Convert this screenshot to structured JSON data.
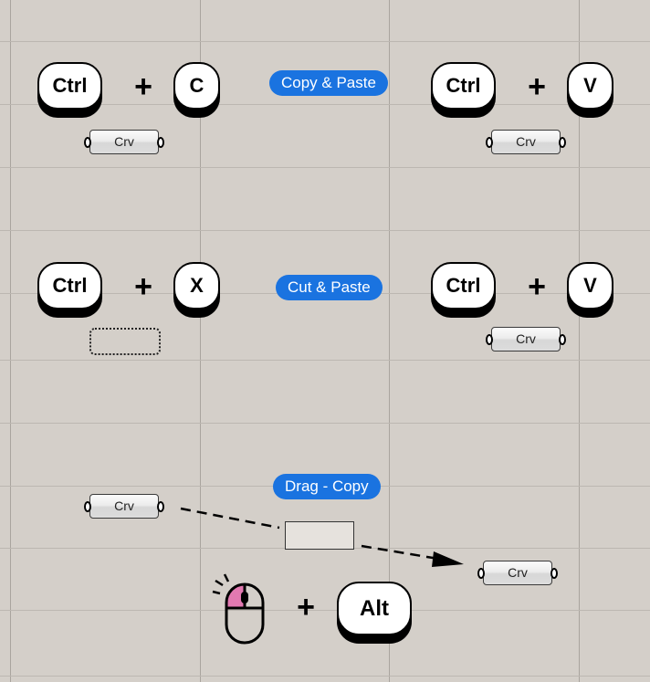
{
  "sections": {
    "copy_paste": {
      "label": "Copy & Paste",
      "left_keys": [
        "Ctrl",
        "C"
      ],
      "right_keys": [
        "Ctrl",
        "V"
      ],
      "left_component": "Crv",
      "right_component": "Crv"
    },
    "cut_paste": {
      "label": "Cut & Paste",
      "left_keys": [
        "Ctrl",
        "X"
      ],
      "right_keys": [
        "Ctrl",
        "V"
      ],
      "right_component": "Crv"
    },
    "drag_copy": {
      "label": "Drag - Copy",
      "source_component": "Crv",
      "target_component": "Crv",
      "modifier_key": "Alt"
    }
  },
  "plus_sign": "+",
  "colors": {
    "canvas": "#d4cfc9",
    "pill": "#1a73e0",
    "mouse_button_highlight": "#e279b1"
  }
}
